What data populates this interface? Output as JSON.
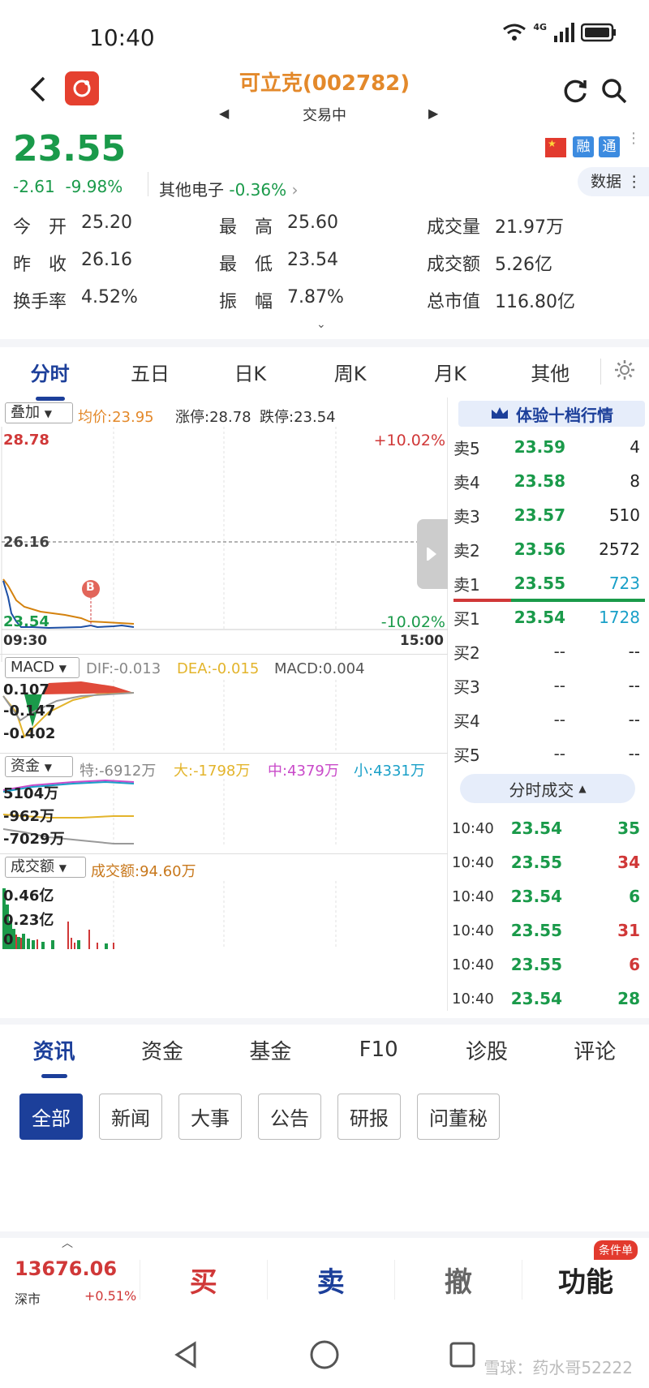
{
  "status": {
    "time": "10:40",
    "network": "4G"
  },
  "header": {
    "title": "可立克(002782)",
    "subtitle": "交易中",
    "prev_icon": "left-triangle-icon",
    "next_icon": "right-triangle-icon"
  },
  "quote": {
    "price": "23.55",
    "change": "-2.61",
    "change_pct": "-9.98%",
    "sector_name": "其他电子",
    "sector_pct": "-0.36%",
    "data_btn": "数据",
    "badges": [
      "融",
      "通"
    ]
  },
  "stats": [
    {
      "label": "今　开",
      "value": "25.20"
    },
    {
      "label": "最　高",
      "value": "25.60"
    },
    {
      "label": "成交量",
      "value": "21.97万"
    },
    {
      "label": "昨　收",
      "value": "26.16"
    },
    {
      "label": "最　低",
      "value": "23.54"
    },
    {
      "label": "成交额",
      "value": "5.26亿"
    },
    {
      "label": "换手率",
      "value": "4.52%"
    },
    {
      "label": "振　幅",
      "value": "7.87%"
    },
    {
      "label": "总市值",
      "value": "116.80亿"
    }
  ],
  "chart_tabs": [
    "分时",
    "五日",
    "日K",
    "周K",
    "月K",
    "其他"
  ],
  "intraday": {
    "overlay_btn": "叠加",
    "avg_label": "均价:23.95",
    "limit_up_label": "涨停:28.78",
    "limit_down_label": "跌停:23.54",
    "y_top": "28.78",
    "y_mid": "26.16",
    "y_bottom": "23.54",
    "pct_top": "+10.02%",
    "pct_bottom": "-10.02%",
    "x_start": "09:30",
    "x_end": "15:00",
    "marker": "B"
  },
  "macd": {
    "btn": "MACD",
    "dif": "DIF:-0.013",
    "dea": "DEA:-0.015",
    "macd": "MACD:0.004",
    "y1": "0.107",
    "y2": "-0.147",
    "y3": "-0.402"
  },
  "fund": {
    "btn": "资金",
    "te": "特:-6912万",
    "da": "大:-1798万",
    "zhong": "中:4379万",
    "xiao": "小:4331万",
    "y1": "5104万",
    "y2": "-962万",
    "y3": "-7029万"
  },
  "volume": {
    "btn": "成交额",
    "amount": "成交额:94.60万",
    "y1": "0.46亿",
    "y2": "0.23亿",
    "y3": "0"
  },
  "order_book": {
    "banner": "体验十档行情",
    "asks": [
      {
        "label": "卖5",
        "price": "23.59",
        "qty": "4"
      },
      {
        "label": "卖4",
        "price": "23.58",
        "qty": "8"
      },
      {
        "label": "卖3",
        "price": "23.57",
        "qty": "510"
      },
      {
        "label": "卖2",
        "price": "23.56",
        "qty": "2572"
      },
      {
        "label": "卖1",
        "price": "23.55",
        "qty": "723"
      }
    ],
    "bids": [
      {
        "label": "买1",
        "price": "23.54",
        "qty": "1728"
      },
      {
        "label": "买2",
        "price": "--",
        "qty": "--"
      },
      {
        "label": "买3",
        "price": "--",
        "qty": "--"
      },
      {
        "label": "买4",
        "price": "--",
        "qty": "--"
      },
      {
        "label": "买5",
        "price": "--",
        "qty": "--"
      }
    ]
  },
  "trades": {
    "header": "分时成交",
    "rows": [
      {
        "time": "10:40",
        "price": "23.54",
        "qty": "35",
        "dir": "sell"
      },
      {
        "time": "10:40",
        "price": "23.55",
        "qty": "34",
        "dir": "buy"
      },
      {
        "time": "10:40",
        "price": "23.54",
        "qty": "6",
        "dir": "sell"
      },
      {
        "time": "10:40",
        "price": "23.55",
        "qty": "31",
        "dir": "buy"
      },
      {
        "time": "10:40",
        "price": "23.55",
        "qty": "6",
        "dir": "buy"
      },
      {
        "time": "10:40",
        "price": "23.54",
        "qty": "28",
        "dir": "sell"
      }
    ]
  },
  "info_tabs": [
    "资讯",
    "资金",
    "基金",
    "F10",
    "诊股",
    "评论"
  ],
  "chips": [
    "全部",
    "新闻",
    "大事",
    "公告",
    "研报",
    "问董秘"
  ],
  "bottom": {
    "index_value": "13676.06",
    "index_name": "深市",
    "index_pct": "+0.51%",
    "buy": "买",
    "sell": "卖",
    "cancel": "撤",
    "func": "功能",
    "func_badge": "条件单"
  },
  "watermark": "雪球：药水哥52222",
  "colors": {
    "up": "#d03838",
    "down": "#1a9a4a",
    "brand": "#1c3f9a",
    "accent": "#e3892b"
  }
}
